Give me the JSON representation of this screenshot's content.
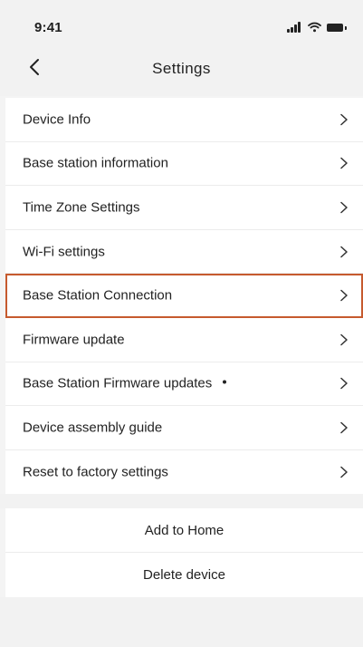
{
  "status_bar": {
    "time": "9:41",
    "icons": [
      "signal-icon",
      "wifi-icon",
      "battery-icon"
    ]
  },
  "header": {
    "title": "Settings",
    "back_icon": "chevron-left-icon"
  },
  "menu": {
    "items": [
      {
        "label": "Device Info",
        "highlighted": false
      },
      {
        "label": "Base station information",
        "highlighted": false
      },
      {
        "label": "Time Zone Settings",
        "highlighted": false
      },
      {
        "label": "Wi-Fi settings",
        "highlighted": false
      },
      {
        "label": "Base Station Connection",
        "highlighted": true
      },
      {
        "label": "Firmware update",
        "highlighted": false
      },
      {
        "label": "Base Station Firmware updates",
        "highlighted": false,
        "has_dot": true
      },
      {
        "label": "Device assembly guide",
        "highlighted": false
      },
      {
        "label": "Reset to factory settings",
        "highlighted": false
      }
    ]
  },
  "actions": {
    "add_to_home": "Add to Home",
    "delete_device": "Delete device"
  },
  "colors": {
    "highlight": "#c65a2e",
    "background": "#f2f2f2",
    "text": "#222222"
  }
}
